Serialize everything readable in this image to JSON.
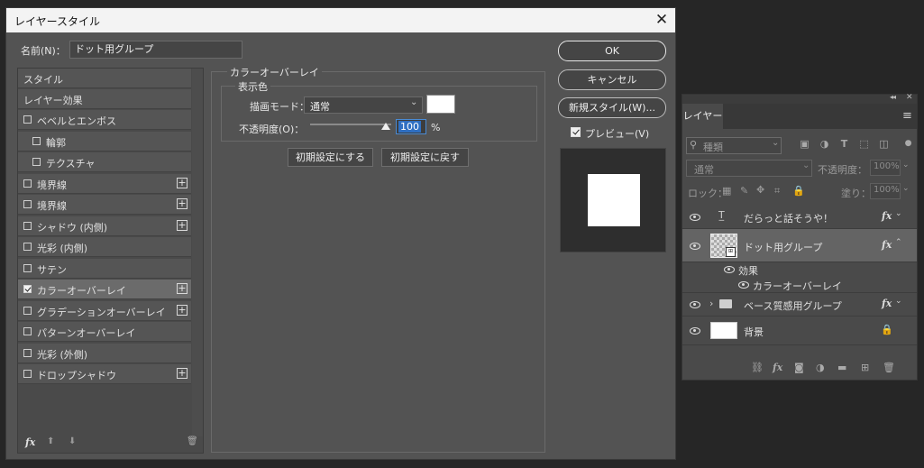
{
  "dialog": {
    "title": "レイヤースタイル",
    "close_glyph": "✕",
    "name_label": "名前(N)：",
    "name_value": "ドット用グループ",
    "list_header": "スタイル",
    "list_section": "レイヤー効果",
    "items": [
      {
        "label": "ベベルとエンボス",
        "checked": false,
        "plus": false
      },
      {
        "label": "輪郭",
        "checked": false,
        "plus": false
      },
      {
        "label": "テクスチャ",
        "checked": false,
        "plus": false
      },
      {
        "label": "境界線",
        "checked": false,
        "plus": true
      },
      {
        "label": "境界線",
        "checked": false,
        "plus": true
      },
      {
        "label": "シャドウ (内側)",
        "checked": false,
        "plus": true
      },
      {
        "label": "光彩 (内側)",
        "checked": false,
        "plus": false
      },
      {
        "label": "サテン",
        "checked": false,
        "plus": false
      },
      {
        "label": "カラーオーバーレイ",
        "checked": true,
        "plus": true
      },
      {
        "label": "グラデーションオーバーレイ",
        "checked": false,
        "plus": true
      },
      {
        "label": "パターンオーバーレイ",
        "checked": false,
        "plus": false
      },
      {
        "label": "光彩 (外側)",
        "checked": false,
        "plus": false
      },
      {
        "label": "ドロップシャドウ",
        "checked": false,
        "plus": true
      }
    ],
    "bottom_icons": {
      "fx": "fx",
      "up": "⬆",
      "down": "⬇",
      "trash": "🗑"
    },
    "overlay": {
      "group_title": "カラーオーバーレイ",
      "subgroup_title": "表示色",
      "blend_label": "描画モード：",
      "blend_value": "通常",
      "swatch_color": "#ffffff",
      "opacity_label": "不透明度(O)：",
      "opacity_value": "100",
      "opacity_unit": "%",
      "btn_default": "初期設定にする",
      "btn_reset": "初期設定に戻す"
    },
    "buttons": {
      "ok": "OK",
      "cancel": "キャンセル",
      "new_style": "新規スタイル(W)..."
    },
    "preview_label": "プレビュー(V)"
  },
  "layers": {
    "tab": "レイヤー",
    "filter_placeholder": "種類",
    "blend": "通常",
    "opacity_label": "不透明度：",
    "opacity_value": "100%",
    "lock_label": "ロック：",
    "fill_label": "塗り：",
    "fill_value": "100%",
    "rows": {
      "text_layer": "だらっと話そうや！",
      "group_dots": "ドット用グループ",
      "effects": "効果",
      "effect_item": "カラーオーバーレイ",
      "group_base": "ベース質感用グループ",
      "background": "背景"
    },
    "fx": "fx"
  }
}
